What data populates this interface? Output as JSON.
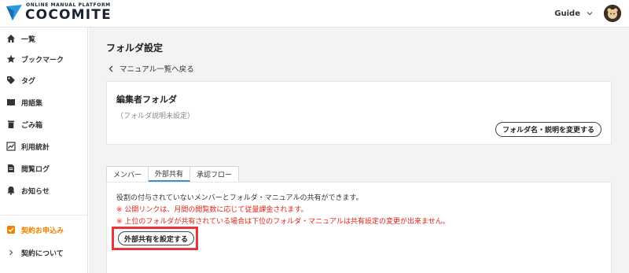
{
  "header": {
    "logo_sub": "ONLINE MANUAL PLATFORM",
    "logo_main": "COCOMITE",
    "user_name": "Guide"
  },
  "sidebar": {
    "items": [
      {
        "label": "一覧",
        "icon": "home-icon"
      },
      {
        "label": "ブックマーク",
        "icon": "star-icon"
      },
      {
        "label": "タグ",
        "icon": "tag-icon"
      },
      {
        "label": "用語集",
        "icon": "book-icon"
      },
      {
        "label": "ごみ箱",
        "icon": "trash-icon"
      },
      {
        "label": "利用統計",
        "icon": "chart-icon"
      },
      {
        "label": "閲覧ログ",
        "icon": "document-icon"
      },
      {
        "label": "お知らせ",
        "icon": "bell-icon"
      }
    ],
    "contract_apply": "契約お申込み",
    "contract_about": "契約について"
  },
  "main": {
    "title": "フォルダ設定",
    "back_link": "マニュアル一覧へ戻る",
    "folder": {
      "name": "編集者フォルダ",
      "description": "（フォルダ説明未設定）",
      "edit_button": "フォルダ名・説明を変更する"
    },
    "tabs": [
      {
        "label": "メンバー",
        "active": false
      },
      {
        "label": "外部共有",
        "active": true
      },
      {
        "label": "承認フロー",
        "active": false
      }
    ],
    "share": {
      "description": "役割の付与されていないメンバーとフォルダ・マニュアルの共有ができます。",
      "note1": "※ 公開リンクは、月間の閲覧数に応じて従量課金されます。",
      "note2": "※ 上位のフォルダが共有されている場合は下位のフォルダ・マニュアルは共有設定の変更が出来ません。",
      "button": "外部共有を設定する"
    }
  },
  "colors": {
    "accent_orange": "#f08300",
    "note_red": "#e2231a",
    "highlight_red": "#e8343a",
    "tab_active_blue": "#3f8fd8",
    "logo_blue": "#2b9be0"
  }
}
